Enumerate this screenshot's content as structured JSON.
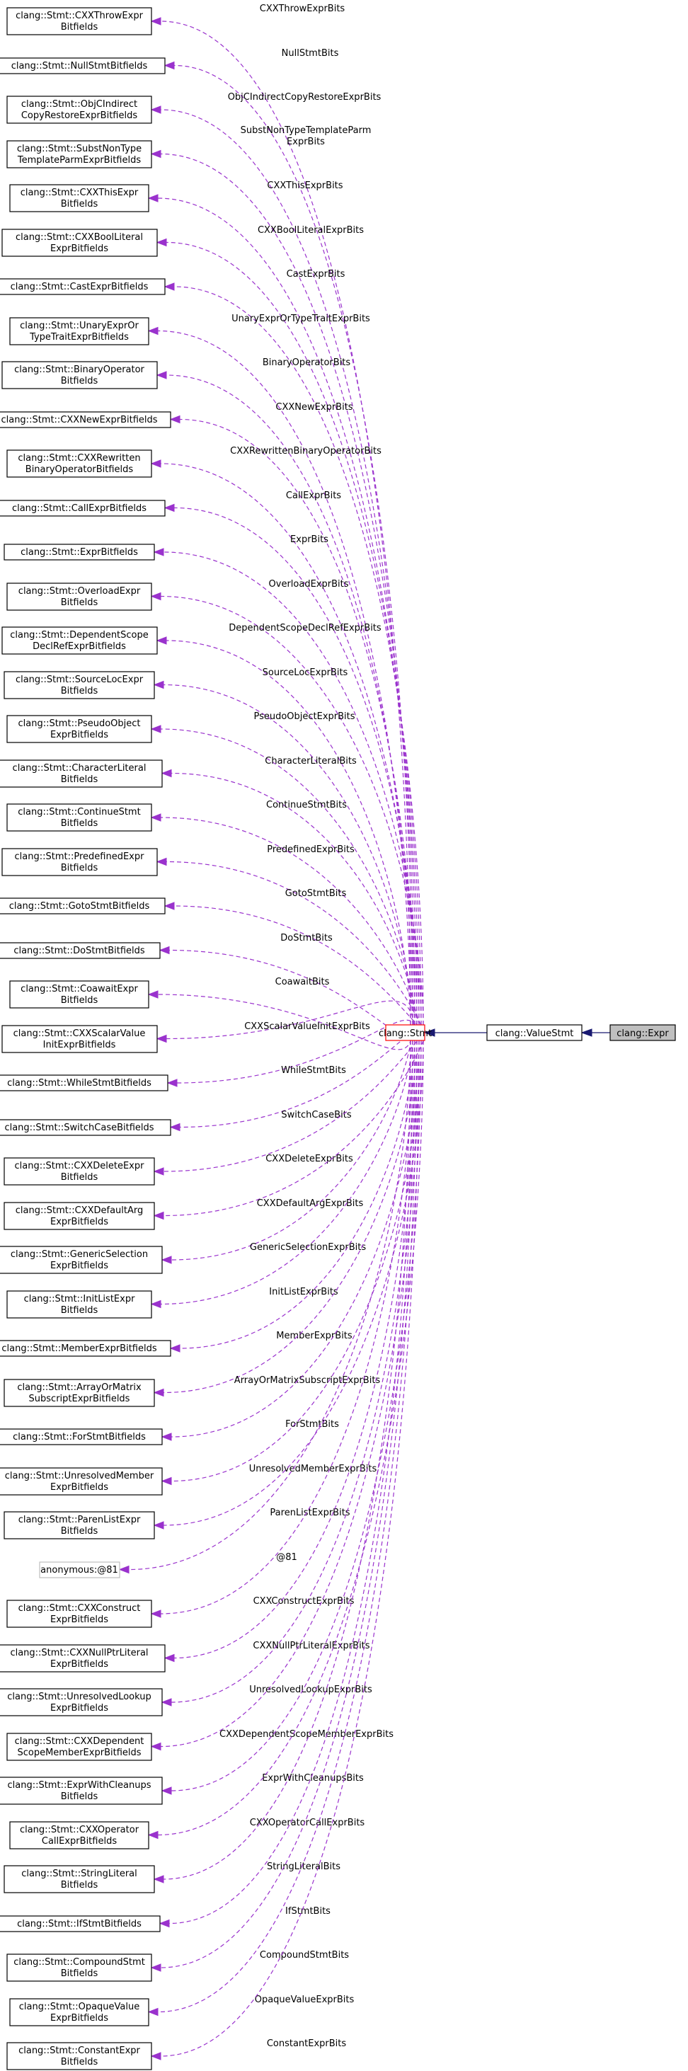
{
  "stmt": "clang::Stmt",
  "value_stmt": "clang::ValueStmt",
  "expr": "clang::Expr",
  "fields": [
    {
      "lines": [
        "clang::Stmt::CXXThrowExpr",
        "Bitfields"
      ],
      "label": [
        "CXXThrowExprBits"
      ]
    },
    {
      "lines": [
        "clang::Stmt::NullStmtBitfields"
      ],
      "label": [
        "NullStmtBits"
      ]
    },
    {
      "lines": [
        "clang::Stmt::ObjCIndirect",
        "CopyRestoreExprBitfields"
      ],
      "label": [
        "ObjCIndirectCopyRestoreExprBits"
      ]
    },
    {
      "lines": [
        "clang::Stmt::SubstNonType",
        "TemplateParmExprBitfields"
      ],
      "label": [
        "SubstNonTypeTemplateParm",
        "ExprBits"
      ]
    },
    {
      "lines": [
        "clang::Stmt::CXXThisExpr",
        "Bitfields"
      ],
      "label": [
        "CXXThisExprBits"
      ]
    },
    {
      "lines": [
        "clang::Stmt::CXXBoolLiteral",
        "ExprBitfields"
      ],
      "label": [
        "CXXBoolLiteralExprBits"
      ]
    },
    {
      "lines": [
        "clang::Stmt::CastExprBitfields"
      ],
      "label": [
        "CastExprBits"
      ]
    },
    {
      "lines": [
        "clang::Stmt::UnaryExprOr",
        "TypeTraitExprBitfields"
      ],
      "label": [
        "UnaryExprOrTypeTraitExprBits"
      ]
    },
    {
      "lines": [
        "clang::Stmt::BinaryOperator",
        "Bitfields"
      ],
      "label": [
        "BinaryOperatorBits"
      ]
    },
    {
      "lines": [
        "clang::Stmt::CXXNewExprBitfields"
      ],
      "label": [
        "CXXNewExprBits"
      ]
    },
    {
      "lines": [
        "clang::Stmt::CXXRewritten",
        "BinaryOperatorBitfields"
      ],
      "label": [
        "CXXRewrittenBinaryOperatorBits"
      ]
    },
    {
      "lines": [
        "clang::Stmt::CallExprBitfields"
      ],
      "label": [
        "CallExprBits"
      ]
    },
    {
      "lines": [
        "clang::Stmt::ExprBitfields"
      ],
      "label": [
        "ExprBits"
      ]
    },
    {
      "lines": [
        "clang::Stmt::OverloadExpr",
        "Bitfields"
      ],
      "label": [
        "OverloadExprBits"
      ]
    },
    {
      "lines": [
        "clang::Stmt::DependentScope",
        "DeclRefExprBitfields"
      ],
      "label": [
        "DependentScopeDeclRefExprBits"
      ]
    },
    {
      "lines": [
        "clang::Stmt::SourceLocExpr",
        "Bitfields"
      ],
      "label": [
        "SourceLocExprBits"
      ]
    },
    {
      "lines": [
        "clang::Stmt::PseudoObject",
        "ExprBitfields"
      ],
      "label": [
        "PseudoObjectExprBits"
      ]
    },
    {
      "lines": [
        "clang::Stmt::CharacterLiteral",
        "Bitfields"
      ],
      "label": [
        "CharacterLiteralBits"
      ]
    },
    {
      "lines": [
        "clang::Stmt::ContinueStmt",
        "Bitfields"
      ],
      "label": [
        "ContinueStmtBits"
      ]
    },
    {
      "lines": [
        "clang::Stmt::PredefinedExpr",
        "Bitfields"
      ],
      "label": [
        "PredefinedExprBits"
      ]
    },
    {
      "lines": [
        "clang::Stmt::GotoStmtBitfields"
      ],
      "label": [
        "GotoStmtBits"
      ]
    },
    {
      "lines": [
        "clang::Stmt::DoStmtBitfields"
      ],
      "label": [
        "DoStmtBits"
      ]
    },
    {
      "lines": [
        "clang::Stmt::CoawaitExpr",
        "Bitfields"
      ],
      "label": [
        "CoawaitBits"
      ]
    },
    {
      "lines": [
        "clang::Stmt::CXXScalarValue",
        "InitExprBitfields"
      ],
      "label": [
        "CXXScalarValueInitExprBits"
      ]
    },
    {
      "lines": [
        "clang::Stmt::WhileStmtBitfields"
      ],
      "label": [
        "WhileStmtBits"
      ]
    },
    {
      "lines": [
        "clang::Stmt::SwitchCaseBitfields"
      ],
      "label": [
        "SwitchCaseBits"
      ]
    },
    {
      "lines": [
        "clang::Stmt::CXXDeleteExpr",
        "Bitfields"
      ],
      "label": [
        "CXXDeleteExprBits"
      ]
    },
    {
      "lines": [
        "clang::Stmt::CXXDefaultArg",
        "ExprBitfields"
      ],
      "label": [
        "CXXDefaultArgExprBits"
      ]
    },
    {
      "lines": [
        "clang::Stmt::GenericSelection",
        "ExprBitfields"
      ],
      "label": [
        "GenericSelectionExprBits"
      ]
    },
    {
      "lines": [
        "clang::Stmt::InitListExpr",
        "Bitfields"
      ],
      "label": [
        "InitListExprBits"
      ]
    },
    {
      "lines": [
        "clang::Stmt::MemberExprBitfields"
      ],
      "label": [
        "MemberExprBits"
      ]
    },
    {
      "lines": [
        "clang::Stmt::ArrayOrMatrix",
        "SubscriptExprBitfields"
      ],
      "label": [
        "ArrayOrMatrixSubscriptExprBits"
      ]
    },
    {
      "lines": [
        "clang::Stmt::ForStmtBitfields"
      ],
      "label": [
        "ForStmtBits"
      ]
    },
    {
      "lines": [
        "clang::Stmt::UnresolvedMember",
        "ExprBitfields"
      ],
      "label": [
        "UnresolvedMemberExprBits"
      ]
    },
    {
      "lines": [
        "clang::Stmt::ParenListExpr",
        "Bitfields"
      ],
      "label": [
        "ParenListExprBits"
      ]
    },
    {
      "lines": [
        "anonymous:@81"
      ],
      "label": [
        "@81"
      ],
      "anon": true
    },
    {
      "lines": [
        "clang::Stmt::CXXConstruct",
        "ExprBitfields"
      ],
      "label": [
        "CXXConstructExprBits"
      ]
    },
    {
      "lines": [
        "clang::Stmt::CXXNullPtrLiteral",
        "ExprBitfields"
      ],
      "label": [
        "CXXNullPtrLiteralExprBits"
      ]
    },
    {
      "lines": [
        "clang::Stmt::UnresolvedLookup",
        "ExprBitfields"
      ],
      "label": [
        "UnresolvedLookupExprBits"
      ]
    },
    {
      "lines": [
        "clang::Stmt::CXXDependent",
        "ScopeMemberExprBitfields"
      ],
      "label": [
        "CXXDependentScopeMemberExprBits"
      ]
    },
    {
      "lines": [
        "clang::Stmt::ExprWithCleanups",
        "Bitfields"
      ],
      "label": [
        "ExprWithCleanupsBits"
      ]
    },
    {
      "lines": [
        "clang::Stmt::CXXOperator",
        "CallExprBitfields"
      ],
      "label": [
        "CXXOperatorCallExprBits"
      ]
    },
    {
      "lines": [
        "clang::Stmt::StringLiteral",
        "Bitfields"
      ],
      "label": [
        "StringLiteralBits"
      ]
    },
    {
      "lines": [
        "clang::Stmt::IfStmtBitfields"
      ],
      "label": [
        "IfStmtBits"
      ]
    },
    {
      "lines": [
        "clang::Stmt::CompoundStmt",
        "Bitfields"
      ],
      "label": [
        "CompoundStmtBits"
      ]
    },
    {
      "lines": [
        "clang::Stmt::OpaqueValue",
        "ExprBitfields"
      ],
      "label": [
        "OpaqueValueExprBits"
      ]
    },
    {
      "lines": [
        "clang::Stmt::ConstantExpr",
        "Bitfields"
      ],
      "label": [
        "ConstantExprBits"
      ]
    }
  ]
}
